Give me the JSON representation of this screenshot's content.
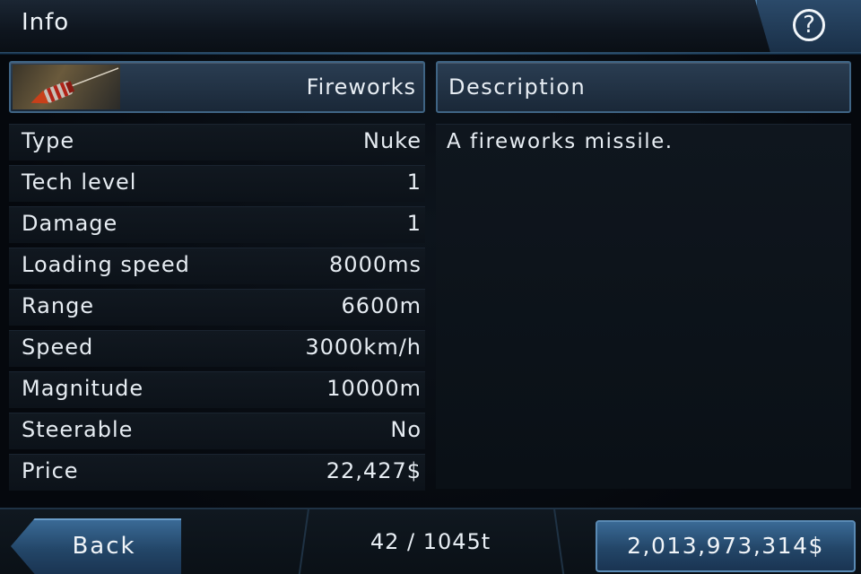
{
  "header": {
    "title": "Info",
    "help_icon": "help-icon"
  },
  "item": {
    "name": "Fireworks",
    "thumbnail_icon": "firework-rocket-icon"
  },
  "stats": [
    {
      "label": "Type",
      "value": "Nuke"
    },
    {
      "label": "Tech level",
      "value": "1"
    },
    {
      "label": "Damage",
      "value": "1"
    },
    {
      "label": "Loading speed",
      "value": "8000ms"
    },
    {
      "label": "Range",
      "value": "6600m"
    },
    {
      "label": "Speed",
      "value": "3000km/h"
    },
    {
      "label": "Magnitude",
      "value": "10000m"
    },
    {
      "label": "Steerable",
      "value": "No"
    },
    {
      "label": "Price",
      "value": "22,427$"
    }
  ],
  "description": {
    "title": "Description",
    "text": "A fireworks missile."
  },
  "footer": {
    "back_label": "Back",
    "capacity": "42 / 1045t",
    "money": "2,013,973,314$"
  },
  "colors": {
    "accent": "#3f6484",
    "button": "#234668",
    "background": "#05080d"
  }
}
